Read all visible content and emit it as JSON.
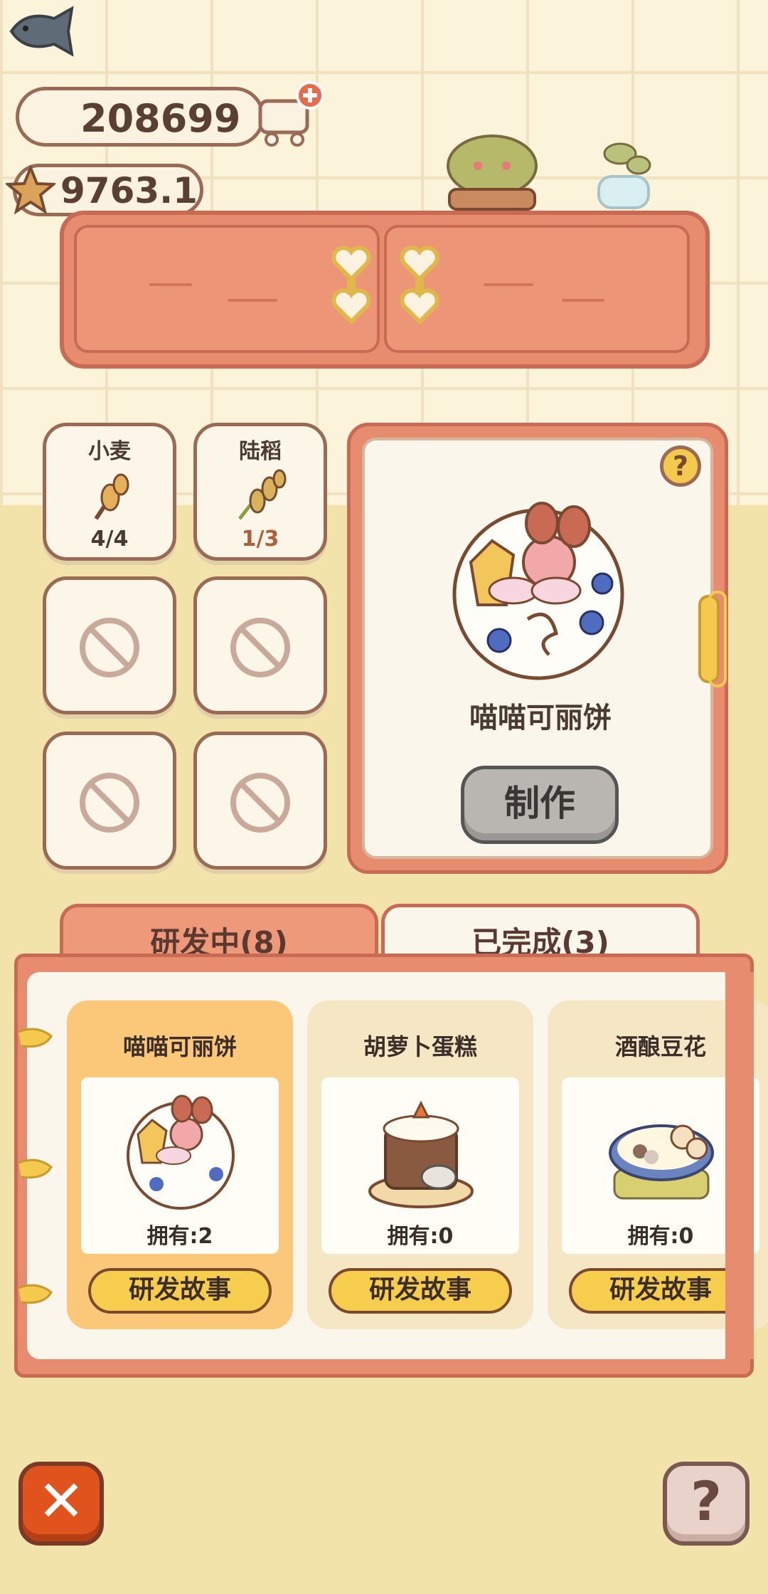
{
  "currency": {
    "fish": "208699",
    "stars": "9763.1"
  },
  "ingredients": [
    {
      "name": "小麦",
      "count": "4/4",
      "count_color": "#4a3a32",
      "icon": "wheat-icon"
    },
    {
      "name": "陆稻",
      "count": "1/3",
      "count_color": "#b15c3a",
      "icon": "rice-icon"
    }
  ],
  "locked_slots": 4,
  "recipe_card": {
    "title": "喵喵可丽饼",
    "make_label": "制作",
    "help": "?"
  },
  "tabs": [
    {
      "label": "研发中(8)",
      "active": true
    },
    {
      "label": "已完成(3)",
      "active": false
    }
  ],
  "recipes": [
    {
      "name": "喵喵可丽饼",
      "owned": "拥有:2",
      "story_label": "研发故事",
      "icon": "crepe-plate-icon",
      "selected": true
    },
    {
      "name": "胡萝卜蛋糕",
      "owned": "拥有:0",
      "story_label": "研发故事",
      "icon": "carrot-cake-icon",
      "selected": false
    },
    {
      "name": "酒酿豆花",
      "owned": "拥有:0",
      "story_label": "研发故事",
      "icon": "tofu-pudding-icon",
      "selected": false
    }
  ],
  "buttons": {
    "close": "✕",
    "help": "?"
  }
}
